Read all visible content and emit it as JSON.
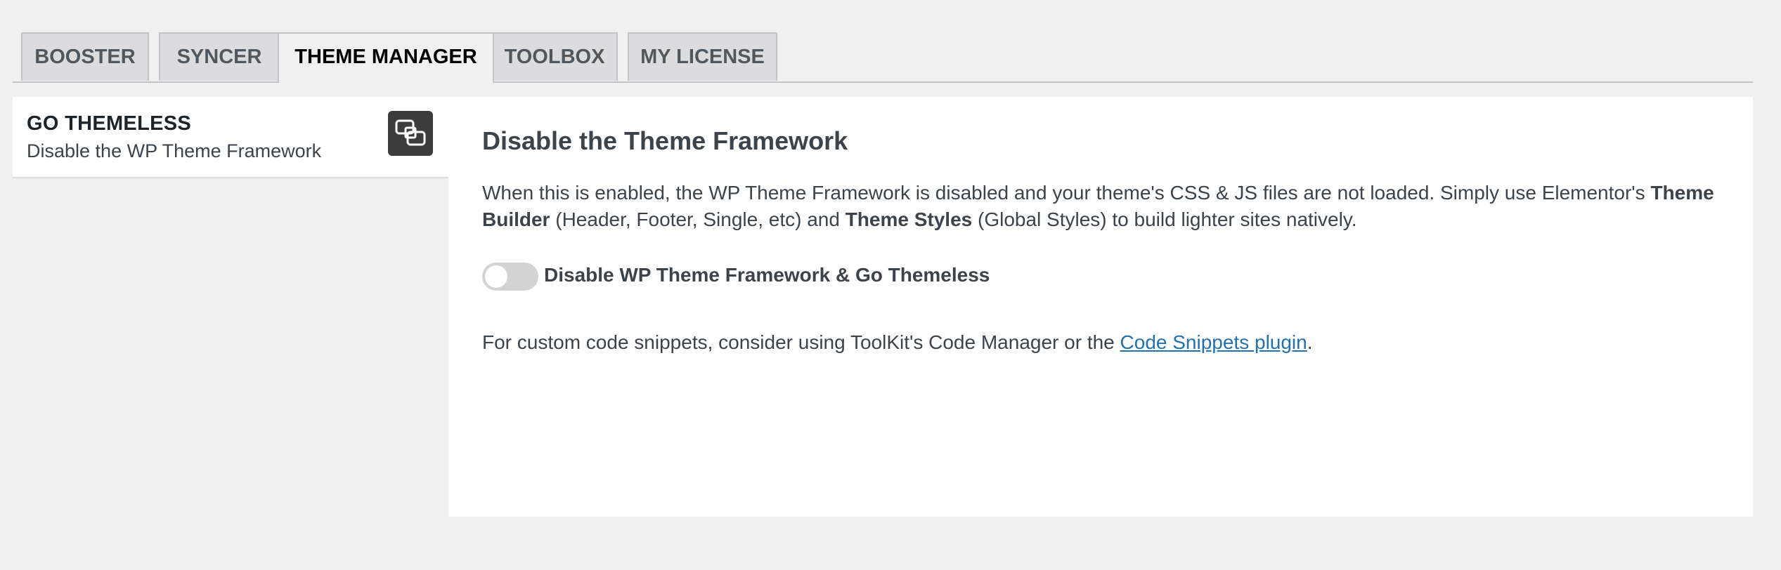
{
  "tabs": [
    {
      "label": "BOOSTER",
      "active": false
    },
    {
      "label": "SYNCER",
      "active": false
    },
    {
      "label": "THEME MANAGER",
      "active": true
    },
    {
      "label": "TOOLBOX",
      "active": false
    },
    {
      "label": "MY LICENSE",
      "active": false
    }
  ],
  "sidebar": {
    "item": {
      "title": "GO THEMELESS",
      "subtitle": "Disable the WP Theme Framework",
      "icon": "overlapping-squares-icon"
    }
  },
  "main": {
    "heading": "Disable the Theme Framework",
    "description": {
      "part1": "When this is enabled, the WP Theme Framework is disabled and your theme's CSS & JS files are not loaded. Simply use Elementor's ",
      "bold1": "Theme Builder",
      "part2": " (Header, Footer, Single, etc) and ",
      "bold2": "Theme Styles",
      "part3": " (Global Styles) to build lighter sites natively."
    },
    "toggle": {
      "label": "Disable WP Theme Framework & Go Themeless",
      "enabled": false
    },
    "footer": {
      "text": "For custom code snippets, consider using ToolKit's Code Manager or the ",
      "link_label": "Code Snippets plugin",
      "suffix": "."
    }
  },
  "colors": {
    "page_bg": "#f0f0f1",
    "panel_bg": "#ffffff",
    "tab_bg": "#dcdcde",
    "link": "#2271b1",
    "toggle_off": "#d3d3d3",
    "icon_bg": "#3c3c3c"
  }
}
